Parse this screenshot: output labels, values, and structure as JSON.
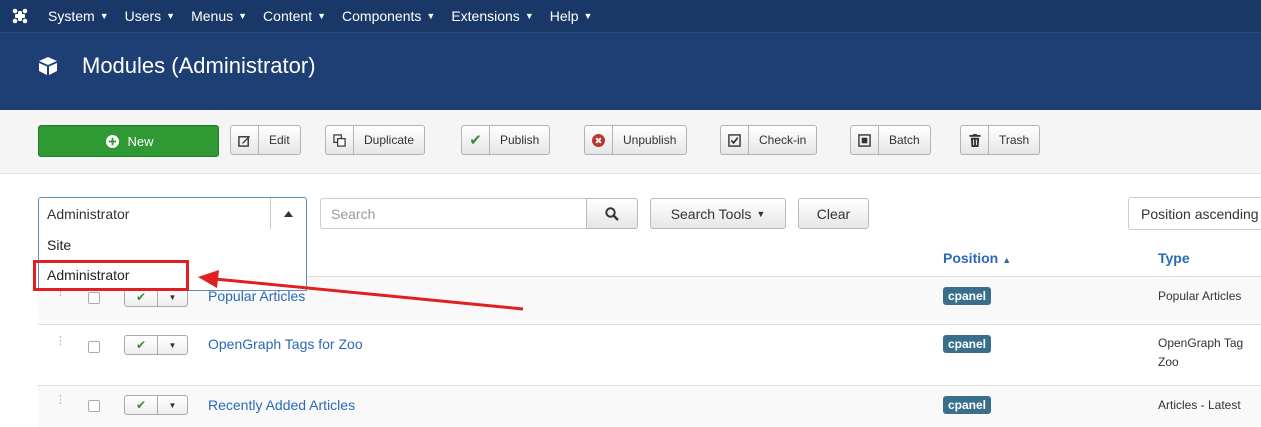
{
  "topnav": {
    "logo_icon": "joomla-logo-icon",
    "items": [
      {
        "label": "System"
      },
      {
        "label": "Users"
      },
      {
        "label": "Menus"
      },
      {
        "label": "Content"
      },
      {
        "label": "Components"
      },
      {
        "label": "Extensions"
      },
      {
        "label": "Help"
      }
    ]
  },
  "header": {
    "icon": "cube-icon",
    "title": "Modules (Administrator)"
  },
  "toolbar": {
    "new_label": "New",
    "buttons": [
      {
        "label": "Edit",
        "icon": "edit-icon"
      },
      {
        "label": "Duplicate",
        "icon": "copy-icon"
      },
      {
        "label": "Publish",
        "icon": "check-icon"
      },
      {
        "label": "Unpublish",
        "icon": "x-circle-icon"
      },
      {
        "label": "Check-in",
        "icon": "checkbox-icon"
      },
      {
        "label": "Batch",
        "icon": "square-icon"
      },
      {
        "label": "Trash",
        "icon": "trash-icon"
      }
    ]
  },
  "filters": {
    "client_select": {
      "selected": "Administrator",
      "options": [
        "Site",
        "Administrator"
      ]
    },
    "search_placeholder": "Search",
    "search_tools_label": "Search Tools",
    "clear_label": "Clear",
    "ordering_value": "Position ascending"
  },
  "table": {
    "headers": {
      "position": "Position",
      "type": "Type"
    },
    "rows": [
      {
        "title": "Popular Articles",
        "position": "cpanel",
        "type": [
          "Popular Articles"
        ]
      },
      {
        "title": "OpenGraph Tags for Zoo",
        "position": "cpanel",
        "type": [
          "OpenGraph Tag",
          "Zoo"
        ]
      },
      {
        "title": "Recently Added Articles",
        "position": "cpanel",
        "type": [
          "Articles - Latest"
        ]
      }
    ]
  },
  "colors": {
    "nav": "#1a3867",
    "header": "#1d3f73",
    "new_button": "#2f9a33",
    "link": "#2a69b8",
    "badge": "#3a6f8c",
    "annotation": "#e02020"
  }
}
